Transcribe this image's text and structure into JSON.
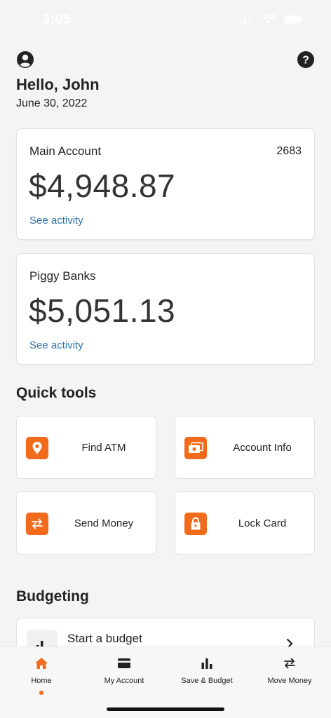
{
  "status_bar": {
    "time": "3:05"
  },
  "header": {
    "greeting": "Hello, John",
    "date": "June 30, 2022"
  },
  "accounts": [
    {
      "title": "Main Account",
      "number": "2683",
      "balance": "$4,948.87",
      "link": "See activity"
    },
    {
      "title": "Piggy Banks",
      "number": "",
      "balance": "$5,051.13",
      "link": "See activity"
    }
  ],
  "quick_tools": {
    "title": "Quick tools",
    "items": [
      {
        "label": "Find ATM",
        "icon": "location-pin-icon"
      },
      {
        "label": "Account Info",
        "icon": "money-bill-icon"
      },
      {
        "label": "Send Money",
        "icon": "transfer-arrows-icon"
      },
      {
        "label": "Lock Card",
        "icon": "lock-icon"
      }
    ]
  },
  "budgeting": {
    "title": "Budgeting",
    "card_title": "Start a budget",
    "icon": "bar-chart-icon"
  },
  "bottom_nav": {
    "items": [
      {
        "label": "Home",
        "icon": "home-icon",
        "active": true
      },
      {
        "label": "My Account",
        "icon": "card-icon"
      },
      {
        "label": "Save & Budget",
        "icon": "bar-chart-icon"
      },
      {
        "label": "Move Money",
        "icon": "transfer-arrows-icon"
      }
    ]
  },
  "colors": {
    "accent": "#f26a1b",
    "link": "#2a73ae",
    "background": "#f4f4f4"
  }
}
